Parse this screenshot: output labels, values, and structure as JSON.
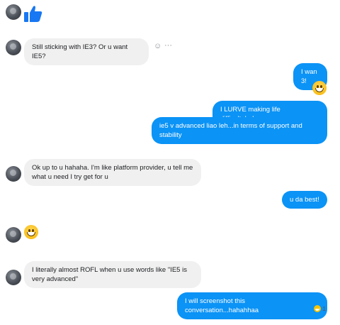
{
  "messages": {
    "in_1": "Still sticking with IE3? Or u want IE5?",
    "out_1": "I wan 3!",
    "out_2": "I LURVE making life difficult..haha",
    "out_3": "ie5 v advanced liao leh...in terms of support and stability",
    "in_2": "Ok up to u hahaha. I'm like platform provider, u tell me what u need I try get for u",
    "out_4": "u da best!",
    "in_3": "I literally almost ROFL when u use words like \"IE5 is very advanced\"",
    "out_5": "I will screenshot this conversation...hahahhaa"
  },
  "reaction": {
    "count": "1",
    "emoji": "grinning-face"
  },
  "colors": {
    "outgoing": "#0b93f6",
    "incoming": "#f0f0f0",
    "like": "#1877f2"
  },
  "icons": [
    "thumbs-up-icon",
    "smiley-icon",
    "more-icon"
  ]
}
